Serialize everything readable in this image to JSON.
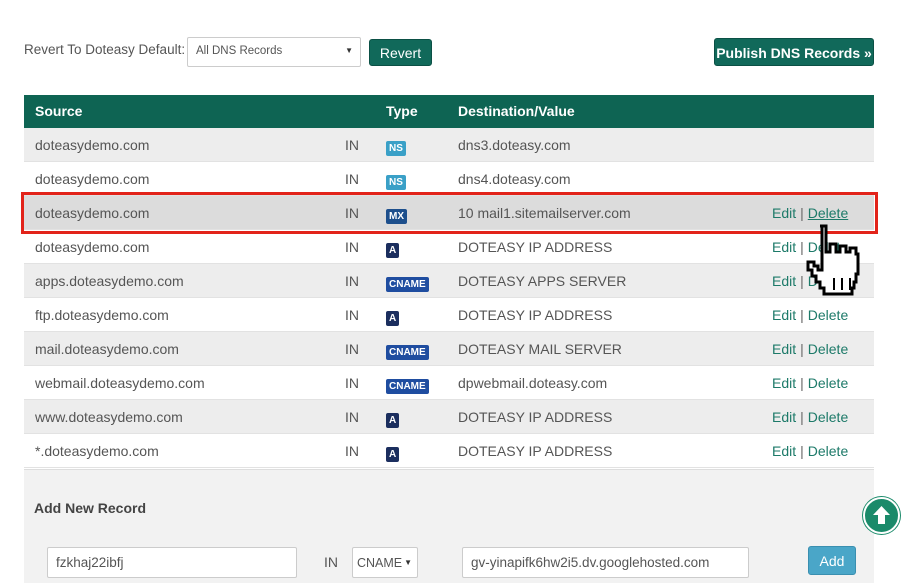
{
  "toolbar": {
    "revert_label": "Revert To Doteasy Default:",
    "revert_select_value": "All DNS Records",
    "revert_button": "Revert",
    "publish_button": "Publish DNS Records »"
  },
  "table": {
    "headers": {
      "source": "Source",
      "type": "Type",
      "destination": "Destination/Value"
    },
    "rows": [
      {
        "source": "doteasydemo.com",
        "in": "IN",
        "type": "NS",
        "destination": "dns3.doteasy.com",
        "edit": "",
        "delete": ""
      },
      {
        "source": "doteasydemo.com",
        "in": "IN",
        "type": "NS",
        "destination": "dns4.doteasy.com",
        "edit": "",
        "delete": ""
      },
      {
        "source": "doteasydemo.com",
        "in": "IN",
        "type": "MX",
        "destination": "10 mail1.sitemailserver.com",
        "edit": "Edit",
        "delete": "Delete"
      },
      {
        "source": "doteasydemo.com",
        "in": "IN",
        "type": "A",
        "destination": "DOTEASY IP ADDRESS",
        "edit": "Edit",
        "delete": "Delete"
      },
      {
        "source": "apps.doteasydemo.com",
        "in": "IN",
        "type": "CNAME",
        "destination": "DOTEASY APPS SERVER",
        "edit": "Edit",
        "delete": "Delete"
      },
      {
        "source": "ftp.doteasydemo.com",
        "in": "IN",
        "type": "A",
        "destination": "DOTEASY IP ADDRESS",
        "edit": "Edit",
        "delete": "Delete"
      },
      {
        "source": "mail.doteasydemo.com",
        "in": "IN",
        "type": "CNAME",
        "destination": "DOTEASY MAIL SERVER",
        "edit": "Edit",
        "delete": "Delete"
      },
      {
        "source": "webmail.doteasydemo.com",
        "in": "IN",
        "type": "CNAME",
        "destination": "dpwebmail.doteasy.com",
        "edit": "Edit",
        "delete": "Delete"
      },
      {
        "source": "www.doteasydemo.com",
        "in": "IN",
        "type": "A",
        "destination": "DOTEASY IP ADDRESS",
        "edit": "Edit",
        "delete": "Delete"
      },
      {
        "source": "*.doteasydemo.com",
        "in": "IN",
        "type": "A",
        "destination": "DOTEASY IP ADDRESS",
        "edit": "Edit",
        "delete": "Delete"
      }
    ]
  },
  "add_record": {
    "title": "Add New Record",
    "source_value": "fzkhaj22ibfj",
    "in_label": "IN",
    "type_value": "CNAME",
    "destination_value": "gv-yinapifk6hw2i5.dv.googlehosted.com",
    "add_button": "Add"
  },
  "colors": {
    "header_green": "#0e6453",
    "highlight_border": "#e2231a",
    "link": "#1d7a69"
  },
  "icons": {
    "cursor": "hand-pointer-icon",
    "scroll_top": "arrow-up-icon"
  }
}
